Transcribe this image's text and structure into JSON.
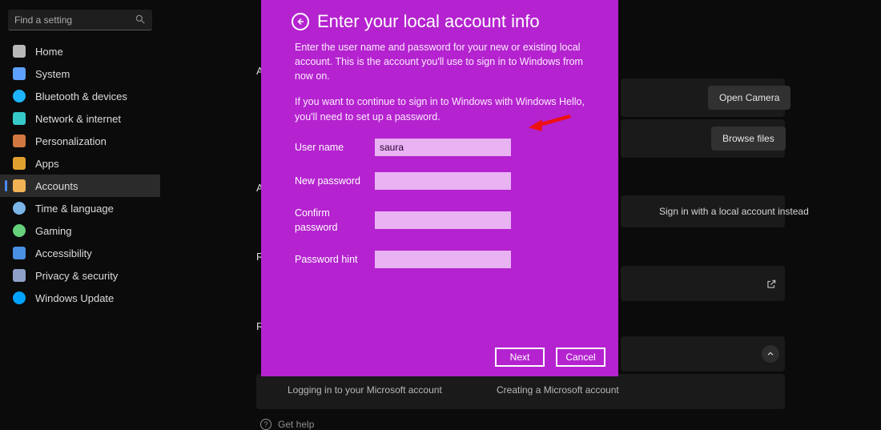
{
  "search": {
    "placeholder": "Find a setting"
  },
  "sidebar": {
    "items": [
      {
        "label": "Home"
      },
      {
        "label": "System"
      },
      {
        "label": "Bluetooth & devices"
      },
      {
        "label": "Network & internet"
      },
      {
        "label": "Personalization"
      },
      {
        "label": "Apps"
      },
      {
        "label": "Accounts"
      },
      {
        "label": "Time & language"
      },
      {
        "label": "Gaming"
      },
      {
        "label": "Accessibility"
      },
      {
        "label": "Privacy & security"
      },
      {
        "label": "Windows Update"
      }
    ],
    "active_index": 6
  },
  "background": {
    "open_camera": "Open Camera",
    "browse_files": "Browse files",
    "sign_in_local": "Sign in with a local account instead",
    "link_left": "Logging in to your Microsoft account",
    "link_right": "Creating a Microsoft account",
    "peek_letters": [
      "A",
      "A",
      "R",
      "R"
    ],
    "get_help": "Get help"
  },
  "dialog": {
    "title": "Enter your local account info",
    "para1": "Enter the user name and password for your new or existing local account. This is the account you'll use to sign in to Windows from now on.",
    "para2": "If you want to continue to sign in to Windows with Windows Hello, you'll need to set up a password.",
    "labels": {
      "user": "User name",
      "newpw": "New password",
      "confirm": "Confirm password",
      "hint": "Password hint"
    },
    "values": {
      "user": "saura",
      "newpw": "",
      "confirm": "",
      "hint": ""
    },
    "buttons": {
      "next": "Next",
      "cancel": "Cancel"
    }
  }
}
